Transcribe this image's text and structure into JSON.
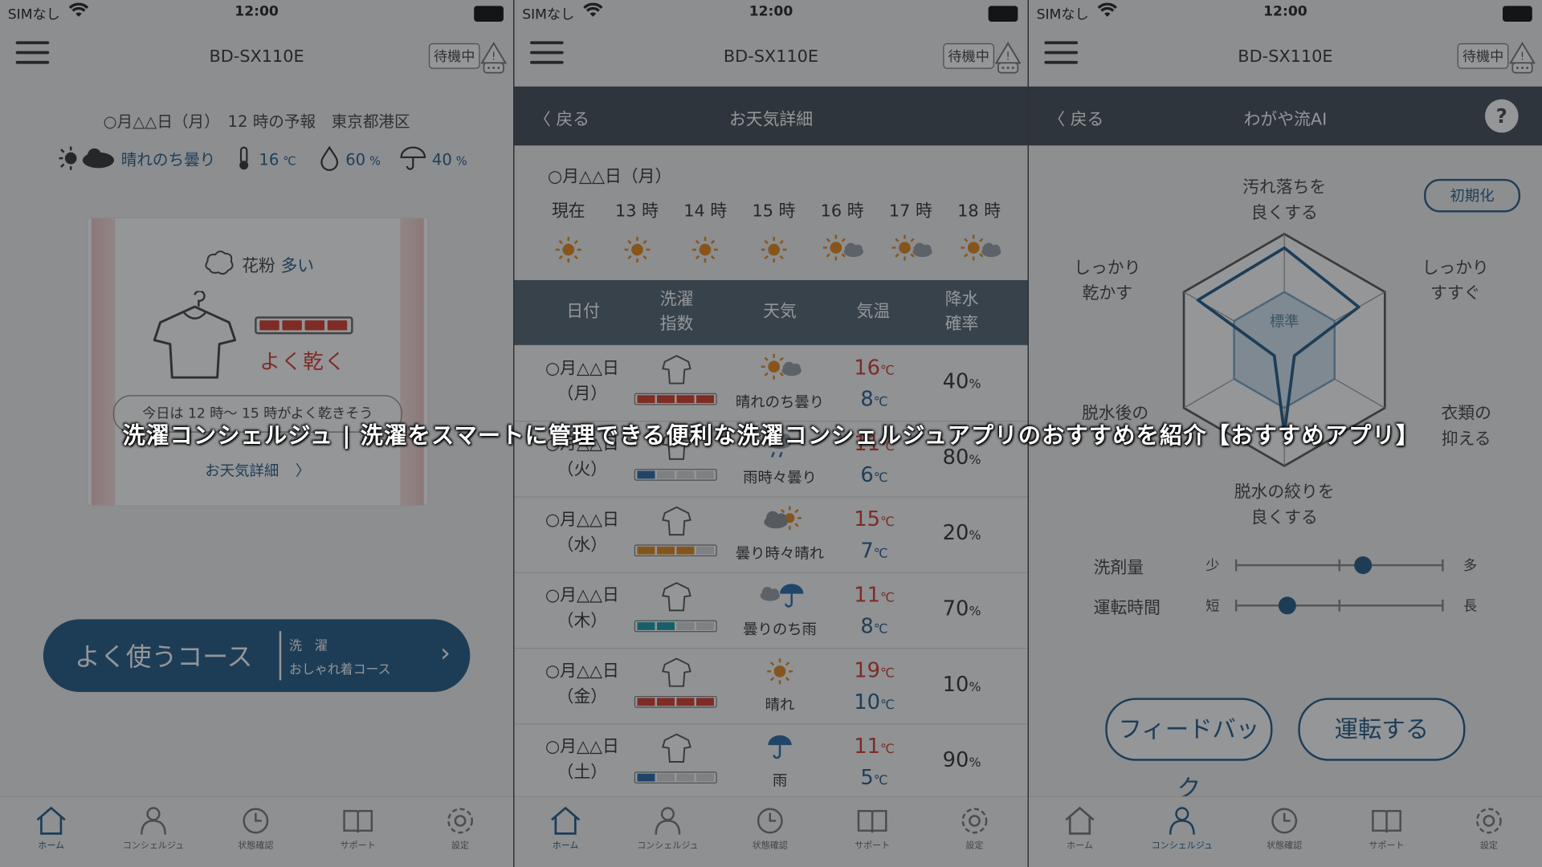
{
  "status": {
    "carrier": "SIMなし",
    "time": "12:00"
  },
  "header": {
    "model": "BD-SX110E",
    "standby": "待機中"
  },
  "home": {
    "forecast_line": "○月△△日（月）　12 時の予報　東京都港区",
    "weather": "晴れのち曇り",
    "temp": "16",
    "temp_unit": "℃",
    "humidity": "60",
    "rain": "40",
    "pct": "%",
    "pollen_label": "花粉",
    "pollen_level": "多い",
    "dry_label": "よく乾く",
    "dry_level": 1.0,
    "bubble": "今日は 12 時～ 15 時がよく乾きそう",
    "detail_link": "お天気詳細",
    "course_title": "よく使うコース",
    "course_sub1": "洗　濯",
    "course_sub2": "おしゃれ着コース"
  },
  "weather_detail": {
    "back": "戻る",
    "title": "お天気詳細",
    "date": "○月△△日（月）",
    "hours": [
      "現在",
      "13 時",
      "14 時",
      "15 時",
      "16 時",
      "17 時",
      "18 時"
    ],
    "hour_icons": [
      "sun-icon",
      "sun-icon",
      "sun-icon",
      "sun-icon",
      "sun-cloud-icon",
      "sun-cloud-icon",
      "sun-cloud-icon"
    ],
    "columns": [
      "日付",
      "洗濯\n指数",
      "天気",
      "気温",
      "降水\n確率"
    ],
    "rows": [
      {
        "date": "○月△△日",
        "dow": "（月）",
        "weather": "晴れのち曇り",
        "hi": "16",
        "lo": "8",
        "rain": "40",
        "index": 4,
        "color": "#d63b2c",
        "icon": "sun-cloud-icon"
      },
      {
        "date": "○月△△日",
        "dow": "（火）",
        "weather": "雨時々曇り",
        "hi": "11",
        "lo": "6",
        "rain": "80",
        "index": 1,
        "color": "#2a6aa8",
        "icon": "rain-cloud-icon"
      },
      {
        "date": "○月△△日",
        "dow": "（水）",
        "weather": "曇り時々晴れ",
        "hi": "15",
        "lo": "7",
        "rain": "20",
        "index": 3,
        "color": "#e08a1e",
        "icon": "cloud-sun-icon"
      },
      {
        "date": "○月△△日",
        "dow": "（木）",
        "weather": "曇りのち雨",
        "hi": "11",
        "lo": "8",
        "rain": "70",
        "index": 2,
        "color": "#1f9aa6",
        "icon": "cloud-umbrella-icon"
      },
      {
        "date": "○月△△日",
        "dow": "（金）",
        "weather": "晴れ",
        "hi": "19",
        "lo": "10",
        "rain": "10",
        "index": 4,
        "color": "#d63b2c",
        "icon": "sun-icon"
      },
      {
        "date": "○月△△日",
        "dow": "（土）",
        "weather": "雨",
        "hi": "11",
        "lo": "5",
        "rain": "90",
        "index": 1,
        "color": "#2a6aa8",
        "icon": "umbrella-icon"
      }
    ],
    "deg": "℃",
    "pct": "%"
  },
  "ai": {
    "back": "戻る",
    "title": "わがや流AI",
    "help": "?",
    "reset": "初期化",
    "axes": [
      "汚れ落ちを\n良くする",
      "しっかり\nすすぐ",
      "衣類の\n傷みを抑える",
      "脱水の絞りを\n良くする",
      "脱水後の\nシワを抑える",
      "しっかり\n乾かす"
    ],
    "axes_visible": [
      "汚れ落ちを\n良くする",
      "しっかり\nすすぐ",
      "衣類の\n抑える",
      "脱水の絞りを\n良くする",
      "脱水後の\n",
      "しっかり\n乾かす"
    ],
    "standard_label": "標準",
    "profile": [
      0.88,
      0.74,
      0.1,
      0.72,
      0.1,
      0.86
    ],
    "standard": [
      0.5,
      0.5,
      0.5,
      0.5,
      0.5,
      0.5
    ],
    "detergent": {
      "label": "洗剤量",
      "lo": "少",
      "hi": "多",
      "value": 0.62
    },
    "runtime": {
      "label": "運転時間",
      "lo": "短",
      "hi": "長",
      "value": 0.25
    },
    "feedback": "フィードバック",
    "run": "運転する"
  },
  "tabs": [
    "ホーム",
    "コンシェルジュ",
    "状態確認",
    "サポート",
    "設定"
  ],
  "caption": "洗濯コンシェルジュ | 洗濯をスマートに管理できる便利な洗濯コンシェルジュアプリのおすすめを紹介【おすすめアプリ】",
  "colors": {
    "accent": "#235c88",
    "hot": "#d63b2c",
    "cold": "#2a5d8a",
    "dark_bar": "#434d55"
  }
}
